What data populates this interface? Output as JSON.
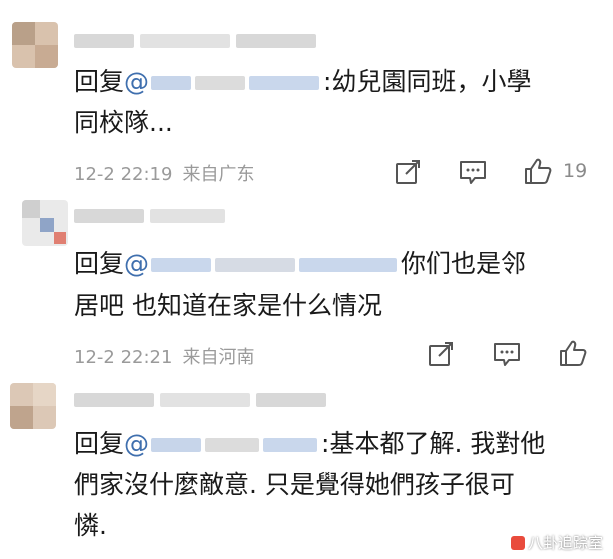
{
  "comments": [
    {
      "reply_prefix": "回复",
      "at": "@",
      "line1_rest": ":幼兒園同班，小學",
      "line2": "同校隊...",
      "date": "12-2 22:19",
      "location": "来自广东",
      "like_count": "19"
    },
    {
      "reply_prefix": "回复",
      "at": "@",
      "line1_rest": "你们也是邻",
      "line2": "居吧 也知道在家是什么情况",
      "date": "12-2 22:21",
      "location": "来自河南",
      "like_count": ""
    },
    {
      "reply_prefix": "回复",
      "at": "@",
      "line1_rest": ":基本都了解. 我對他",
      "line2": "們家沒什麼敵意. 只是覺得她們孩子很可",
      "line3": "憐.",
      "date": "",
      "location": "",
      "like_count": ""
    }
  ],
  "icons": {
    "share": "share-icon",
    "comment": "comment-icon",
    "like": "thumbs-up-icon"
  },
  "colors": {
    "mention": "#3f6fae",
    "meta": "#9a9a9a",
    "icon": "#555555"
  },
  "watermark": "八卦追踪室"
}
